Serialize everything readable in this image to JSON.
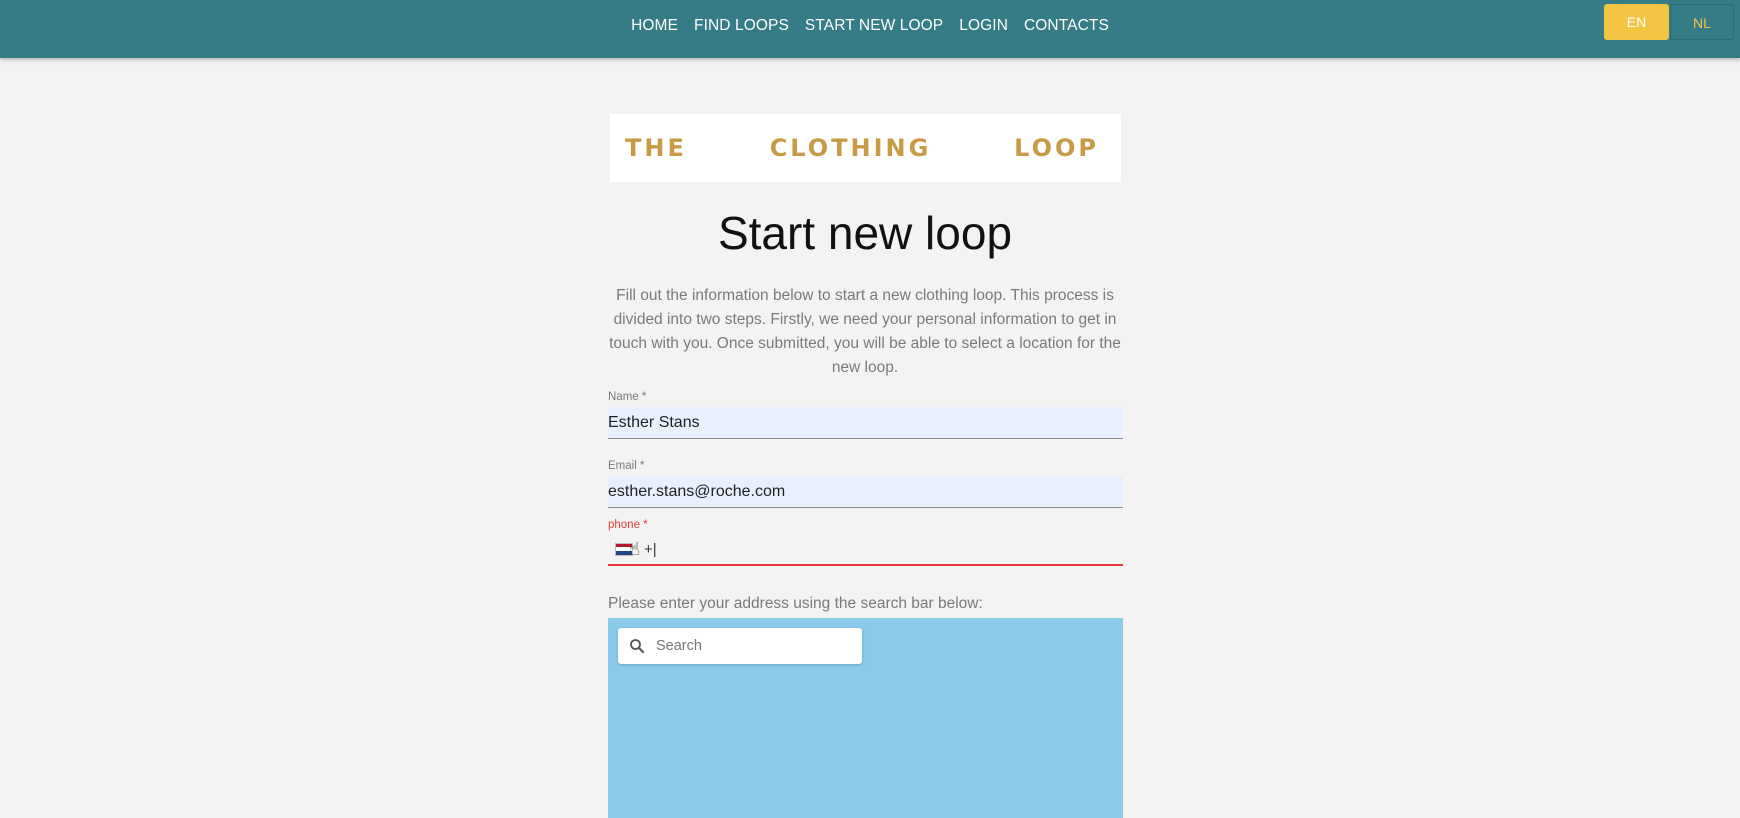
{
  "nav": {
    "items": [
      "HOME",
      "FIND LOOPS",
      "START NEW LOOP",
      "LOGIN",
      "CONTACTS"
    ]
  },
  "lang": {
    "en": "EN",
    "nl": "NL",
    "selected": "EN"
  },
  "logo": {
    "words": [
      "THE",
      "CLOTHING",
      "LOOP"
    ]
  },
  "page": {
    "title": "Start new loop",
    "intro": "Fill out the information below to start a new clothing loop. This process is divided into two steps. Firstly, we need your personal information to get in touch with you. Once submitted, you will be able to select a location for the new loop."
  },
  "form": {
    "name": {
      "label": "Name *",
      "value": "Esther Stans"
    },
    "email": {
      "label": "Email *",
      "value": "esther.stans@roche.com"
    },
    "phone": {
      "label": "phone *",
      "value": "+|",
      "flag": "netherlands-flag-icon"
    },
    "address_label": "Please enter your address using the search bar below:"
  },
  "map": {
    "search_placeholder": "Search",
    "background": "#89cbe8"
  },
  "colors": {
    "nav_bg": "#357c87",
    "accent": "#f4c542",
    "logo_text": "#c99a46",
    "error": "#e53935"
  }
}
